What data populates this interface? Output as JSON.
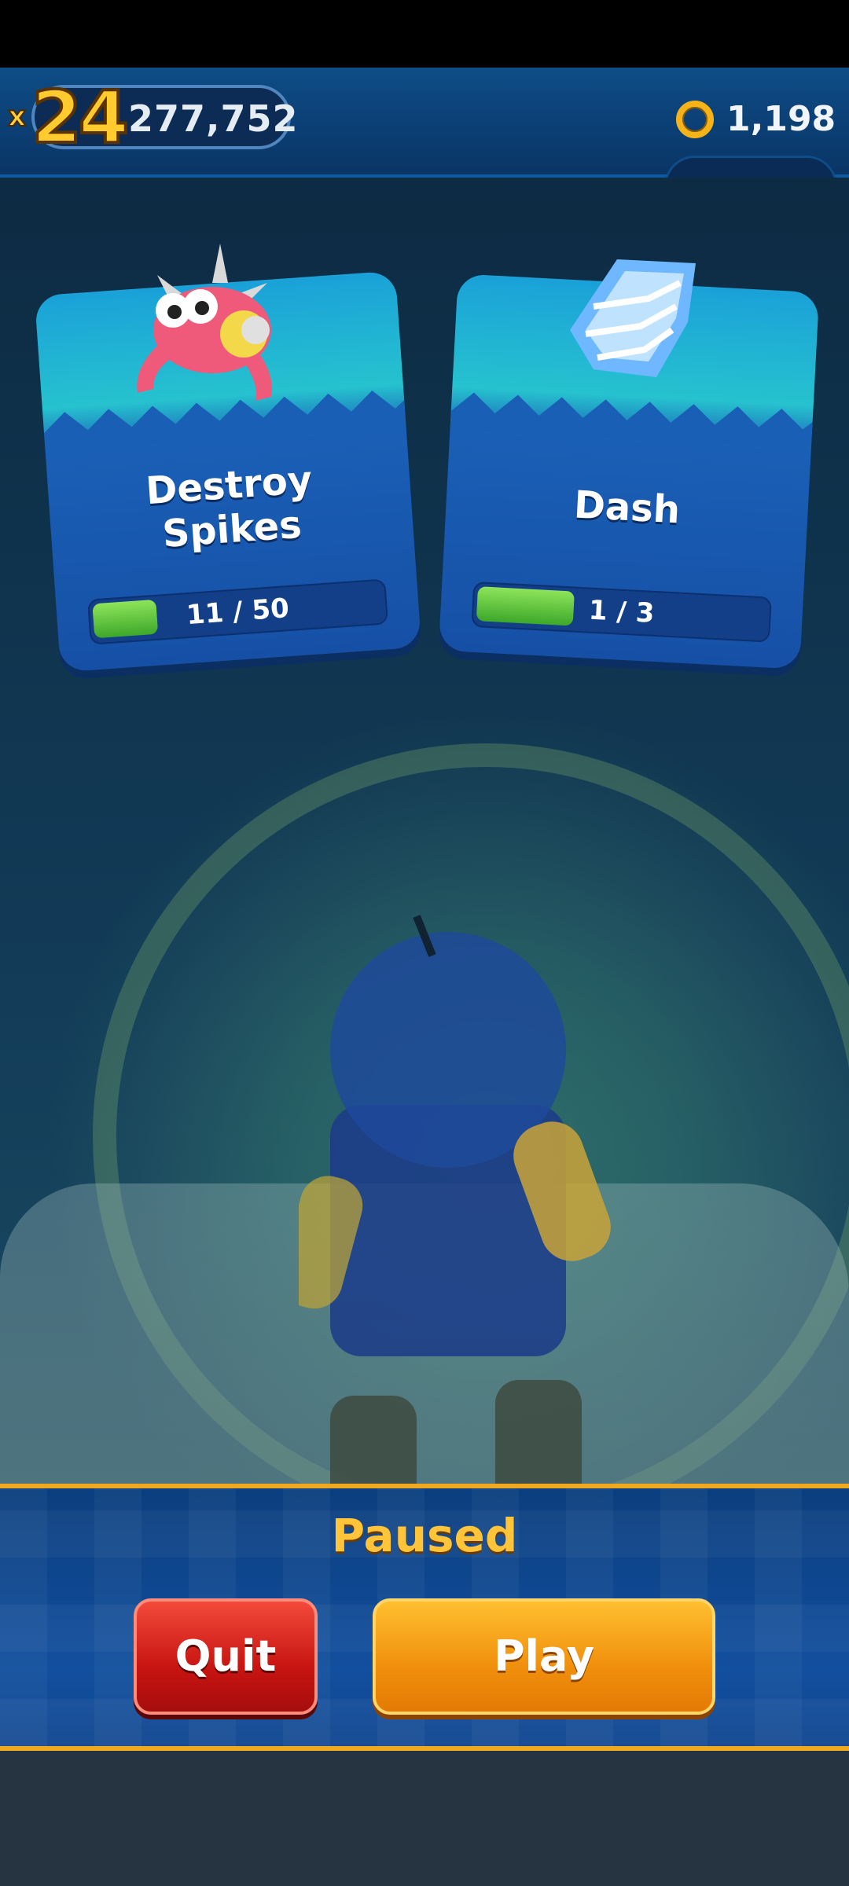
{
  "hud": {
    "multiplier_prefix": "x",
    "multiplier": "24",
    "score": "277,752",
    "rings": "1,198"
  },
  "missions": [
    {
      "title_line1": "Destroy",
      "title_line2": "Spikes",
      "progress_text": "11 / 50",
      "progress": 0.22,
      "icon": "spiky-crab-enemy-icon"
    },
    {
      "title_line1": "Dash",
      "title_line2": "",
      "progress_text": "1 / 3",
      "progress": 0.333,
      "icon": "dash-crystal-icon"
    }
  ],
  "pause": {
    "title": "Paused",
    "quit_label": "Quit",
    "play_label": "Play"
  },
  "colors": {
    "accent_gold": "#f0a81f",
    "quit_red": "#c81411",
    "play_orange": "#f08f0c",
    "progress_green": "#5cc23a"
  }
}
